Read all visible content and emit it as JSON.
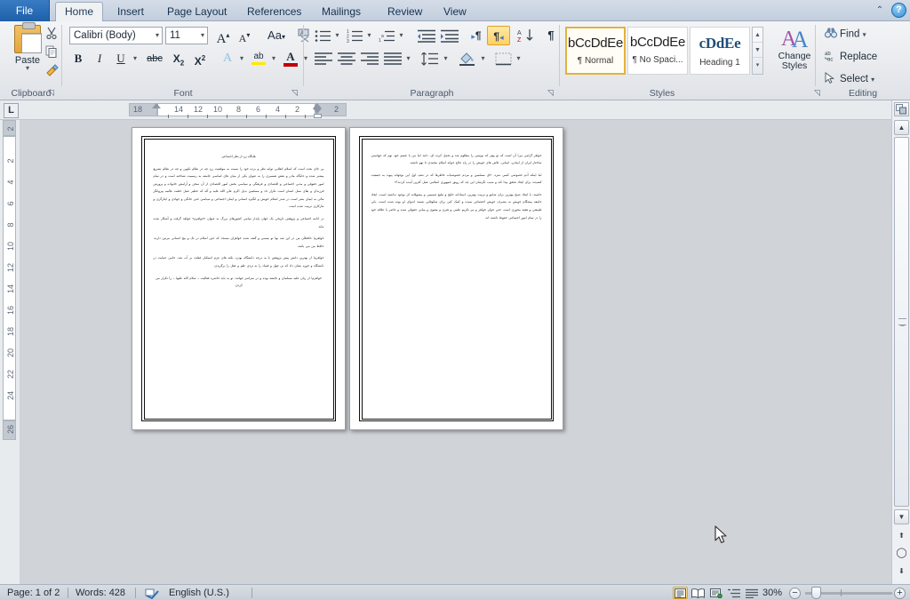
{
  "window": {
    "app": "Microsoft Word",
    "help_label": "?",
    "minimize_ribbon_label": "⌃"
  },
  "tabs": [
    {
      "label": "File",
      "name": "tab-file"
    },
    {
      "label": "Home",
      "name": "tab-home"
    },
    {
      "label": "Insert",
      "name": "tab-insert"
    },
    {
      "label": "Page Layout",
      "name": "tab-page-layout"
    },
    {
      "label": "References",
      "name": "tab-references"
    },
    {
      "label": "Mailings",
      "name": "tab-mailings"
    },
    {
      "label": "Review",
      "name": "tab-review"
    },
    {
      "label": "View",
      "name": "tab-view"
    }
  ],
  "active_tab": "Home",
  "ribbon": {
    "clipboard": {
      "label": "Clipboard",
      "paste_label": "Paste",
      "cut_label": "Cut",
      "copy_label": "Copy",
      "format_painter_label": "Format Painter",
      "dialog_launcher": "⌐"
    },
    "font": {
      "label": "Font",
      "font_name": "Calibri (Body)",
      "font_size": "11",
      "grow_font_label": "A",
      "shrink_font_label": "A",
      "change_case_label": "Aa",
      "clear_formatting_label": "Clear Formatting",
      "bold_label": "B",
      "italic_label": "I",
      "underline_label": "U",
      "strikethrough_label": "abc",
      "subscript_label": "X",
      "superscript_label": "X",
      "text_effects_label": "A",
      "highlight_label": "ab",
      "font_color_label": "A",
      "dialog_launcher": "⌐"
    },
    "paragraph": {
      "label": "Paragraph",
      "bullets_label": "Bullets",
      "numbering_label": "Numbering",
      "multilevel_label": "Multilevel List",
      "decrease_indent_label": "Decrease Indent",
      "increase_indent_label": "Increase Indent",
      "ltr_label": "Left-to-Right Text Direction",
      "rtl_label": "Right-to-Left Text Direction",
      "sort_label": "Sort",
      "show_marks_label": "¶",
      "align_left_label": "Align Text Left",
      "align_center_label": "Center",
      "align_right_label": "Align Text Right",
      "justify_label": "Justify",
      "line_spacing_label": "Line and Paragraph Spacing",
      "shading_label": "Shading",
      "borders_label": "Borders",
      "rtl_active": true,
      "dialog_launcher": "⌐"
    },
    "styles": {
      "label": "Styles",
      "items": [
        {
          "preview": "bCcDdEe",
          "name": "¶ Normal",
          "selected": true
        },
        {
          "preview": "bCcDdEe",
          "name": "¶ No Spaci...",
          "selected": false
        },
        {
          "preview": "cDdEe",
          "name": "Heading 1",
          "selected": false
        }
      ],
      "scroll_up": "▲",
      "scroll_down": "▼",
      "more": "▾",
      "change_styles_line1": "Change",
      "change_styles_line2": "Styles",
      "dialog_launcher": "⌐"
    },
    "editing": {
      "label": "Editing",
      "find_label": "Find",
      "replace_label": "Replace",
      "select_label": "Select"
    }
  },
  "ruler": {
    "tab_stop_selector": "L",
    "horizontal_ticks": [
      "18",
      "14",
      "12",
      "10",
      "8",
      "6",
      "4",
      "2",
      "2"
    ],
    "vertical_ticks": [
      "2",
      "2",
      "4",
      "6",
      "8",
      "10",
      "12",
      "14",
      "16",
      "18",
      "20",
      "22",
      "24",
      "26"
    ]
  },
  "document": {
    "pages": [
      {
        "number": 1,
        "heading": "هایگاه زن از نظر اجتماعی",
        "paragraphs": [
          "بی جای بحث است که اسلام انقلابی توانه نظر و برده خود را نسبت به موقعیت زن چه در نظام تکوین و چه در نظام تشریع بیشتر شده و جایگاه مادر و نقش همسری را به عنوان یکی از بنیان های اساسی جامعه به رسمیت شناخته است و در تمام امور حقوقی و مدنی اجتماعی و اقتصادی و فرهنگی و سیاسی بخش امور اقتصادی از آن سخن و آرامش خانواده و پرورش فرزندان و بقای نسل انسان است تکرار داد و مسلمین بدیل اکرم علی الله علیه و آله که خطیر عمل خلقت عالمه پیروانگر مالی به ایمان بشر است در صدر اسلام خویش و انگیزه انسانی و ایمان اجتماعی و سیاسی حتی خانگی و جهادی و ایثارگری و نثارکاری تربیت شده است.",
          "در ادامه اجتماعی و پژوهش تاریخی یک جهان پایدار تمامی کشورهای بزرگ به عنوان «خواهرم» خواهد گرفت و آشکار شده نیاید.",
          "خواهرم! حافظان من در این شد نها تو نیستی و گفته شده خواهران مسجد که حین اسلام در تک و بیج انسانی مرتین دارند، حافظ من می باشد.",
          "خواهرم! از بهترین دانش پیش پژوهش با به درجه دانشگاه بودن، نکته های عزم استکبار غفلت بر آب شد، حامی حمایت در دانشگاه و حوزه نشان داد که تن جهل و فساد را به تردی علم و عقل را برگزیدی.",
          "خواهرم! از زنان علیه مسلمان و جامعه بوده و در سراسر جهانند، تو به باید حاضره فعالیت – سلام الله علیها – را تکرار می کردی."
        ]
      },
      {
        "number": 2,
        "heading": "",
        "paragraphs": [
          "خواهر گرامی من! آن است که تو بهتر که نویسی را مظلوم شد و تحمل کرده ای، دانند اما من با چشم خود نوم که جهانبینی ساختار ایران از ایمانی، ایمانی، تلاش های خویش را در راه دفاع جوانه اسلام محمدی تا نهو داشته.",
          "اما اینکه آدم خصوصی کسی سزد، «ای مسلمین و مردم خصوصیات خاطرها که در صف اول این توجهاند پیوند به جمعیت کشیدند برای ایجاد تحقق پیدا کند و سبب نگرشان این چه که رونق جمهوری اسلامی عمل آفرین آینده کردند؟»",
          "خانمند: با ایجاد صبح بهترین برای شامو و تربیت بهترین، استادانه خلیج و تبلیغ صمیمی و مشوقانه ای بوجود نداشته است، ایجاد جامعه پیشگام خویش به مصرف خویش اختصاص نمیده و کمک کنی برای شکوفایی شمند اندوای او بوده شده است، بانی طبیعتی و هفته محوری است، حتی جوان خواهر و نیز تکریم علمی و هنری و معنوی و میانی حقوقی شده و حاضر با علاقه خود را در تمام امور اجتماعی حفوظ داشته اند."
        ]
      }
    ]
  },
  "status": {
    "page_info": "Page: 1 of 2",
    "word_count": "Words: 428",
    "proofing_icon": "proofing-errors-icon",
    "language": "English (U.S.)",
    "views": [
      {
        "name": "print-layout",
        "label": "Print Layout",
        "active": true
      },
      {
        "name": "full-screen-reading",
        "label": "Full Screen Reading",
        "active": false
      },
      {
        "name": "web-layout",
        "label": "Web Layout",
        "active": false
      },
      {
        "name": "outline",
        "label": "Outline",
        "active": false
      },
      {
        "name": "draft",
        "label": "Draft",
        "active": false
      }
    ],
    "zoom_level": "30%",
    "zoom_out": "−",
    "zoom_in": "+"
  },
  "colors": {
    "accent": "#1d5fa8",
    "ribbon_bg": "#eaedf1",
    "canvas_bg": "#d0d3d8",
    "highlight": "#ffd164",
    "page_white": "#ffffff"
  }
}
